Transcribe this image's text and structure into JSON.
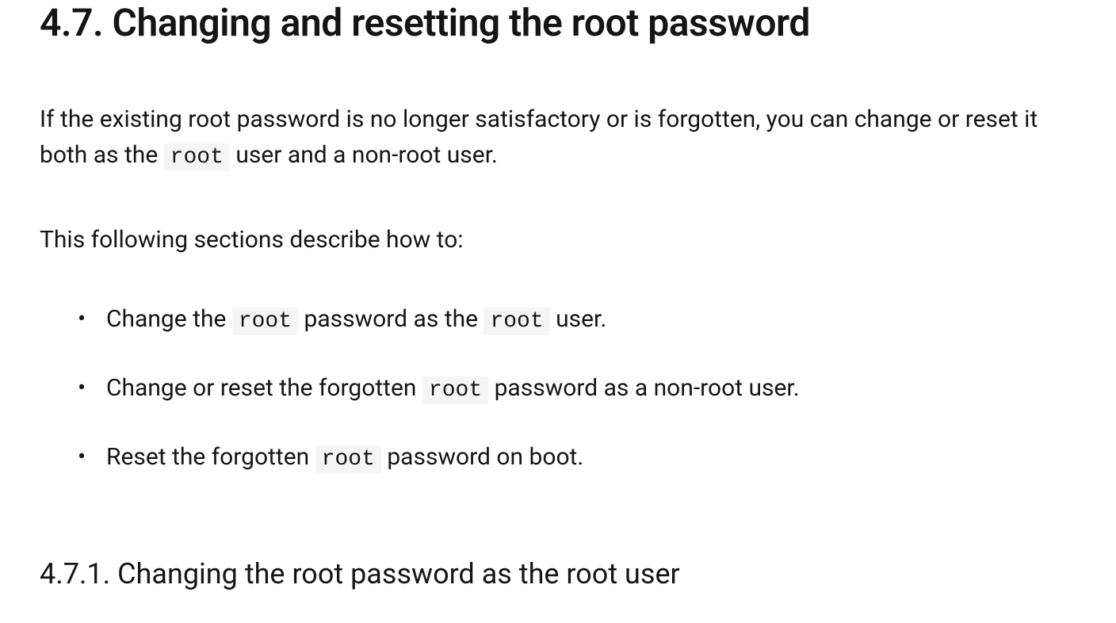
{
  "heading": "4.7. Changing and resetting the root password",
  "intro": {
    "part1": "If the existing root password is no longer satisfactory or is forgotten, you can change or reset it both as the ",
    "code1": "root",
    "part2": " user and a non-root user."
  },
  "listIntro": "This following sections describe how to:",
  "items": [
    {
      "seg1": "Change the ",
      "code1": "root",
      "seg2": " password as the ",
      "code2": "root",
      "seg3": " user."
    },
    {
      "seg1": "Change or reset the forgotten ",
      "code1": "root",
      "seg2": " password as a non-root user.",
      "code2": "",
      "seg3": ""
    },
    {
      "seg1": "Reset the forgotten ",
      "code1": "root",
      "seg2": " password on boot.",
      "code2": "",
      "seg3": ""
    }
  ],
  "subheading": "4.7.1. Changing the root password as the root user"
}
